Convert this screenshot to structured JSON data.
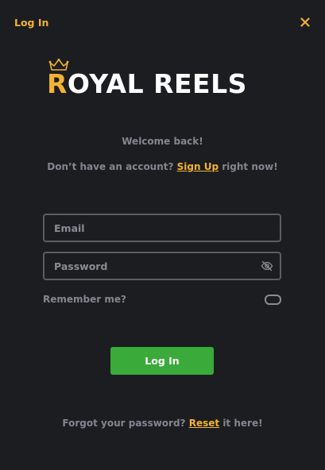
{
  "header": {
    "title": "Log In",
    "close_icon": "close-icon"
  },
  "logo": {
    "first_letter": "R",
    "rest": "OYAL REELS",
    "icon": "crown-icon"
  },
  "welcome_text": "Welcome back!",
  "signup": {
    "prefix": "Don’t have an account?",
    "link": "Sign Up",
    "suffix": "right now!"
  },
  "form": {
    "email_placeholder": "Email",
    "password_placeholder": "Password",
    "password_toggle_icon": "eye-off-icon",
    "remember_label": "Remember me?",
    "remember_checked": false
  },
  "login_button": "Log In",
  "forgot": {
    "prefix": "Forgot your password?",
    "link": "Reset",
    "suffix": "it here!"
  },
  "colors": {
    "accent": "#f2b233",
    "primary_button": "#3aaa3a",
    "background": "#1c1d21",
    "muted_text": "#84868f"
  }
}
